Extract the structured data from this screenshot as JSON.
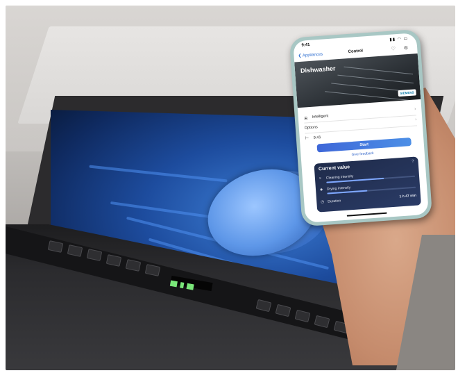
{
  "phone": {
    "status_time": "9:41",
    "status_icons": "▮▮ ◠ ▭",
    "nav_back": "❮ Appliances",
    "nav_title": "Control",
    "nav_icons": "♡ ⚙",
    "hero_title": "Dishwasher",
    "brand": "SIEMENS",
    "rows": [
      {
        "icon": "⦿",
        "label": "Intelligent"
      },
      {
        "icon": "",
        "label": "Options"
      },
      {
        "icon": "⊢",
        "label": "9:41"
      }
    ],
    "start_label": "Start",
    "feedback_label": "Give feedback",
    "current_value": {
      "title": "Current value",
      "help": "?",
      "items": [
        {
          "icon": "≈",
          "label": "Cleaning intensity",
          "value": "",
          "level": 0.65
        },
        {
          "icon": "◈",
          "label": "Drying intensity",
          "value": "",
          "level": 0.45
        },
        {
          "icon": "◷",
          "label": "Duration",
          "value": "1 h 47 min",
          "level": null
        }
      ]
    }
  },
  "dishwasher_panel": {
    "display_text": "▇▇ ▇ ▇▇"
  },
  "colors": {
    "interior_glow": "#3e7fd6",
    "phone_case": "#a8c7c4",
    "start_button": "#4c8fe6",
    "card_bg": "#1f2b4a"
  }
}
